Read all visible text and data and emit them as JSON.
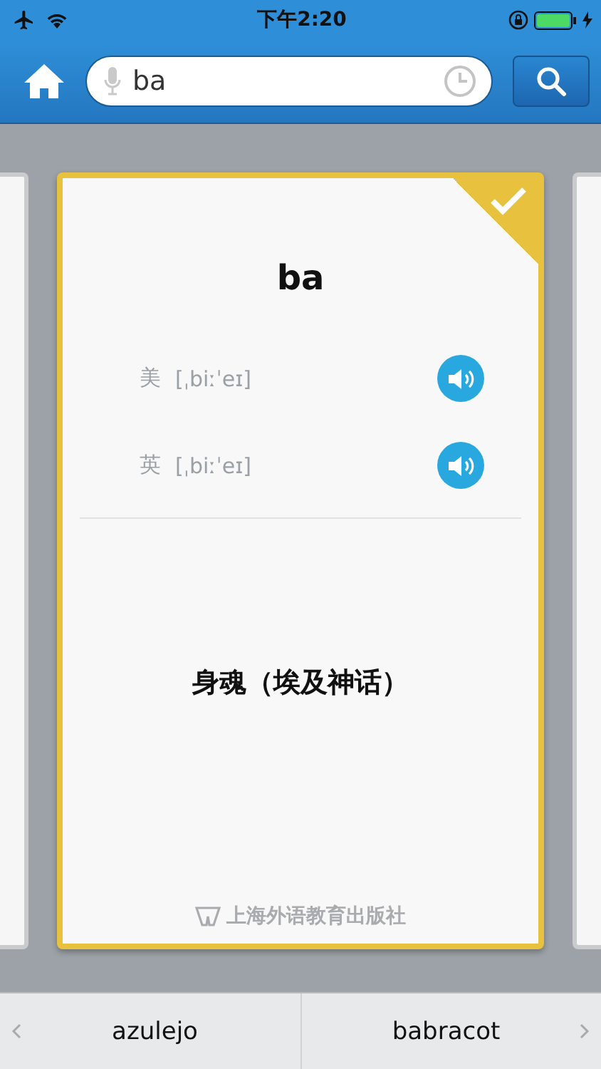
{
  "status_bar": {
    "time": "下午2:20"
  },
  "search": {
    "value": "ba"
  },
  "card": {
    "word": "ba",
    "bookmarked": true,
    "pronunciations": [
      {
        "region": "美",
        "phonetic": "[ˌbiːˈeɪ]"
      },
      {
        "region": "英",
        "phonetic": "[ˌbiːˈeɪ]"
      }
    ],
    "definition": "身魂（埃及神话）",
    "publisher": "上海外语教育出版社"
  },
  "bottom_nav": {
    "previous": "azulejo",
    "next": "babracot"
  }
}
